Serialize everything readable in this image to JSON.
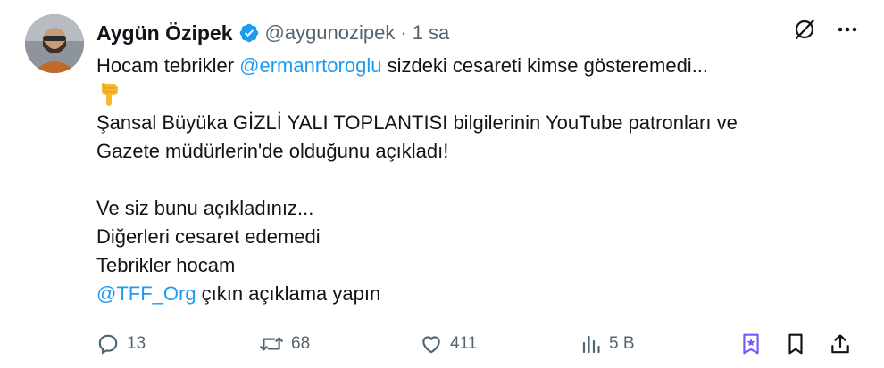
{
  "author": {
    "name": "Aygün Özipek",
    "handle": "@aygunozipek",
    "separator": "·",
    "time": "1 sa"
  },
  "colors": {
    "link": "#1d9bf0",
    "verified": "#1d9bf0",
    "muted": "#536471",
    "grok": "#7856ff"
  },
  "tweet": {
    "line1_pre": "Hocam tebrikler ",
    "line1_mention": "@ermanrtoroglu",
    "line1_post": " sizdeki cesareti kimse gösteremedi...",
    "emoji": "pointing-down-hand",
    "line2": "Şansal Büyüka GİZLİ YALI TOPLANTISI bilgilerinin YouTube patronları ve",
    "line3": "Gazete müdürlerin'de olduğunu açıkladı!",
    "line4": "Ve siz bunu açıkladınız...",
    "line5": "Diğerleri cesaret edemedi",
    "line6": "Tebrikler hocam",
    "line7_mention": "@TFF_Org",
    "line7_post": " çıkın açıklama yapın"
  },
  "actions": {
    "replies": "13",
    "reposts": "68",
    "likes": "411",
    "views": "5 B"
  },
  "icons": [
    "grok-icon",
    "more-icon",
    "reply-icon",
    "repost-icon",
    "like-icon",
    "views-icon",
    "grok-actions-icon",
    "bookmark-icon",
    "share-icon",
    "verified-icon"
  ]
}
